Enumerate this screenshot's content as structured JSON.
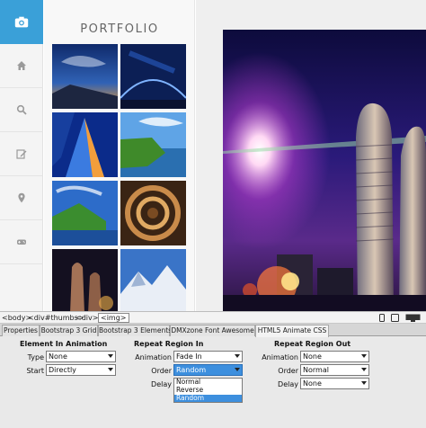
{
  "portfolio": {
    "title": "PORTFOLIO"
  },
  "rail": {
    "icons": [
      "camera-icon",
      "home-icon",
      "search-icon",
      "edit-icon",
      "location-pin-icon",
      "gamepad-icon"
    ],
    "accent": "#3aa0d8"
  },
  "tagbar": {
    "tags": [
      "<body>",
      "<div#thumbs>",
      "<div>",
      "<img>"
    ]
  },
  "tabs": [
    "Properties",
    "Bootstrap 3 Grid",
    "Bootstrap 3 Elements",
    "DMXzone Font Awesome",
    "HTML5 Animate CSS"
  ],
  "panel": {
    "element_in": {
      "title": "Element In Animation",
      "type_label": "Type",
      "type_value": "None",
      "start_label": "Start",
      "start_value": "Directly"
    },
    "repeat_in": {
      "title": "Repeat Region In",
      "animation_label": "Animation",
      "animation_value": "Fade In",
      "order_label": "Order",
      "order_value": "Random",
      "delay_label": "Delay",
      "order_options": [
        "Normal",
        "Reverse",
        "Random"
      ],
      "order_selected": "Random"
    },
    "repeat_out": {
      "title": "Repeat Region Out",
      "animation_label": "Animation",
      "animation_value": "None",
      "order_label": "Order",
      "order_value": "Normal",
      "delay_label": "Delay",
      "delay_value": "None"
    }
  },
  "colors": {
    "selection": "#3d8fde"
  }
}
